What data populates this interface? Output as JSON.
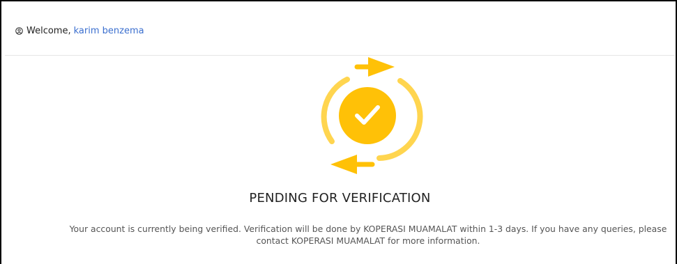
{
  "header": {
    "icon": "user-circle-icon",
    "welcome_label": "Welcome,",
    "user_name": "karim benzema"
  },
  "status": {
    "icon": "sync-check-icon",
    "title": "PENDING FOR VERIFICATION",
    "message": "Your account is currently being verified. Verification will be done by KOPERASI MUAMALAT within 1-3 days. If you have any queries, please contact KOPERASI MUAMALAT for more information."
  },
  "colors": {
    "accent_yellow": "#FFC107",
    "arc_yellow": "#FFD54F",
    "link_blue": "#3B6FCF"
  }
}
